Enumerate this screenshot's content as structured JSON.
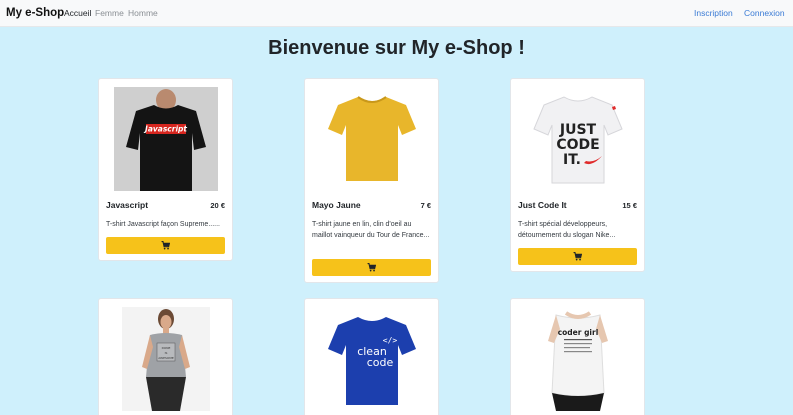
{
  "navbar": {
    "brand": "My e-Shop",
    "links": [
      "Accueil",
      "Femme",
      "Homme"
    ],
    "right_links": [
      "Inscription",
      "Connexion"
    ]
  },
  "main": {
    "title": "Bienvenue sur My e-Shop !"
  },
  "products": [
    {
      "name": "Javascript",
      "price": "20 €",
      "description": "T-shirt Javascript façon Supreme......",
      "image_text": "Javascript",
      "cart_icon": "cart-icon"
    },
    {
      "name": "Mayo Jaune",
      "price": "7 €",
      "description": "T-shirt jaune en lin, clin d'oeil au maillot vainqueur du Tour de France...",
      "cart_icon": "cart-icon"
    },
    {
      "name": "Just Code It",
      "price": "15 €",
      "description": "T-shirt spécial développeurs, détournement du slogan Nike...",
      "image_text_lines": [
        "JUST",
        "CODE",
        "IT."
      ],
      "cart_icon": "cart-icon"
    },
    {
      "image_text_lines": [
        "DONE",
        "IS",
        "AWESOME"
      ]
    },
    {
      "image_text_lines": [
        "clean",
        "code"
      ],
      "image_symbol": "</>"
    },
    {
      "image_text": "coder girl"
    }
  ],
  "colors": {
    "page_bg": "#cff0fc",
    "button": "#f6c21a",
    "link": "#3a7bd5"
  }
}
